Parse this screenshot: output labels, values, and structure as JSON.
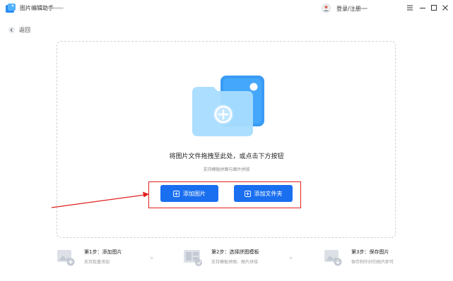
{
  "app": {
    "title": "图片编辑助手",
    "logo_icon": "app-logo-icon"
  },
  "header": {
    "login_label": "登录/注册",
    "avatar_icon": "user-avatar-icon"
  },
  "window_controls": [
    "menu-icon",
    "minimize-icon",
    "maximize-icon",
    "close-icon"
  ],
  "nav": {
    "back_label": "返回"
  },
  "upload": {
    "main_text": "将图片文件拖拽至此处，或点击下方按钮",
    "sub_text": "支持模板拼图与图片拼接",
    "buttons": {
      "add_image": "添加图片",
      "add_folder": "添加文件夹"
    }
  },
  "steps": [
    {
      "title": "第1步：添加图片",
      "desc": "支持批量添加"
    },
    {
      "title": "第2步：选择拼图模板",
      "desc": "支持模板拼图、图片拼接"
    },
    {
      "title": "第3步：保存图片",
      "desc": "保存制作好的图片即可"
    }
  ],
  "colors": {
    "primary": "#1a6ff0",
    "annotation": "#e02020"
  }
}
